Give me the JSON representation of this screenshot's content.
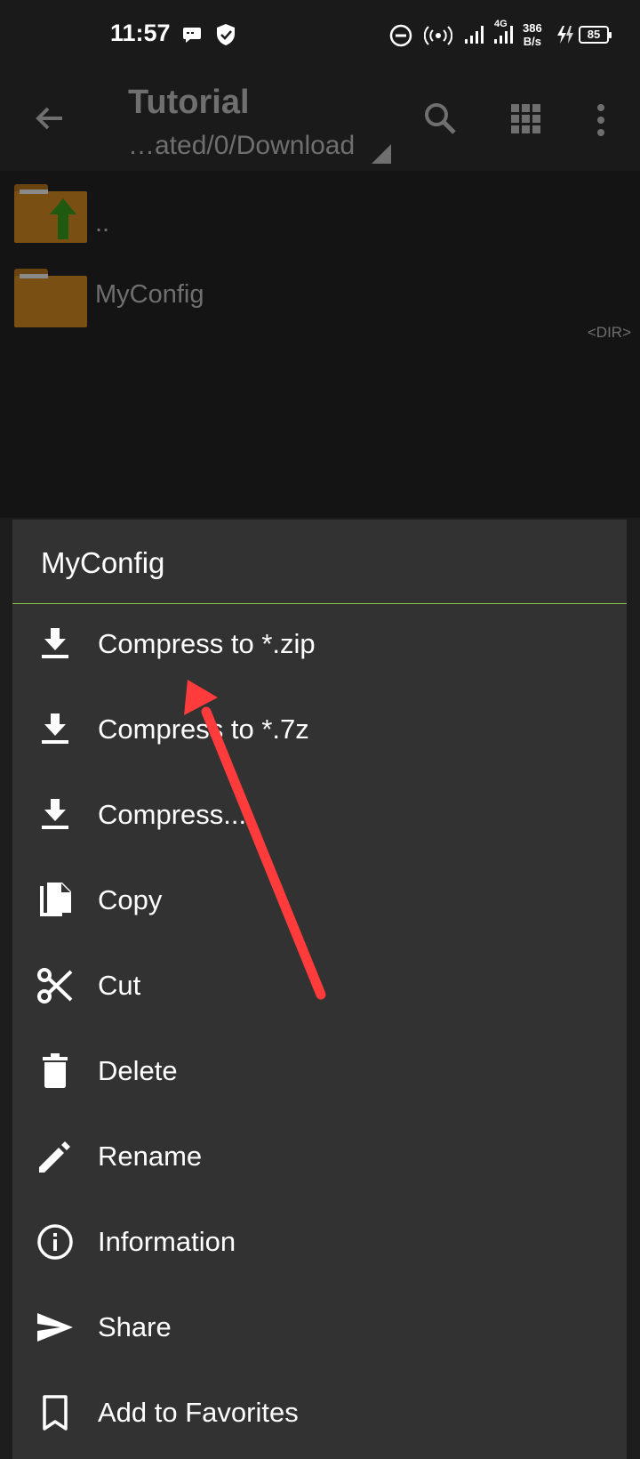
{
  "status_bar": {
    "time": "11:57",
    "network_type": "4G",
    "net_speed_value": "386",
    "net_speed_unit": "B/s",
    "battery": "85"
  },
  "toolbar": {
    "title": "Tutorial",
    "path": "…ated/0/Download"
  },
  "files": [
    {
      "name": "..",
      "type": "parent"
    },
    {
      "name": "MyConfig",
      "type": "folder",
      "tag": "<DIR>"
    }
  ],
  "context_menu": {
    "title": "MyConfig",
    "items": [
      {
        "label": "Compress to *.zip",
        "icon": "download-icon"
      },
      {
        "label": "Compress to *.7z",
        "icon": "download-icon"
      },
      {
        "label": "Compress...",
        "icon": "download-icon"
      },
      {
        "label": "Copy",
        "icon": "copy-icon"
      },
      {
        "label": "Cut",
        "icon": "scissors-icon"
      },
      {
        "label": "Delete",
        "icon": "trash-icon"
      },
      {
        "label": "Rename",
        "icon": "pencil-icon"
      },
      {
        "label": "Information",
        "icon": "info-icon"
      },
      {
        "label": "Share",
        "icon": "send-icon"
      },
      {
        "label": "Add to Favorites",
        "icon": "bookmark-icon"
      }
    ]
  },
  "colors": {
    "menu_bg": "#323232",
    "accent_divider": "#8bc34a",
    "annotation_arrow": "#ff3b3b",
    "folder": "#7a4f14"
  }
}
